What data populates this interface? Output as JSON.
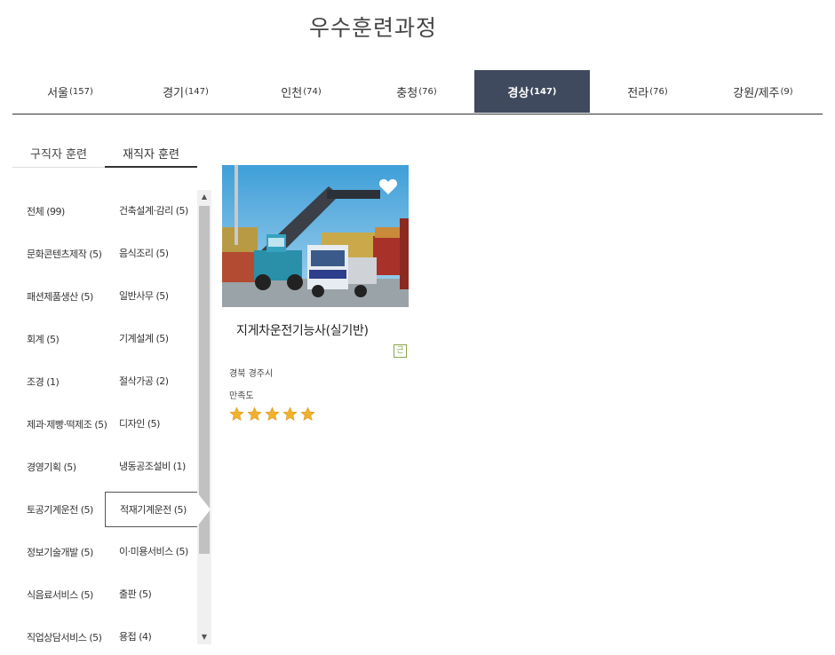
{
  "page": {
    "title": "우수훈련과정"
  },
  "region_tabs": [
    {
      "label": "서울",
      "count": "(157)",
      "active": false
    },
    {
      "label": "경기",
      "count": "(147)",
      "active": false
    },
    {
      "label": "인천",
      "count": "(74)",
      "active": false
    },
    {
      "label": "충청",
      "count": "(76)",
      "active": false
    },
    {
      "label": "경상",
      "count": "(147)",
      "active": true
    },
    {
      "label": "전라",
      "count": "(76)",
      "active": false
    },
    {
      "label": "강원/제주",
      "count": "(9)",
      "active": false
    }
  ],
  "sub_tabs": [
    {
      "label": "구직자 훈련",
      "active": false
    },
    {
      "label": "재직자 훈련",
      "active": true
    }
  ],
  "categories": [
    [
      "전체 (99)",
      "건축설계·감리 (5)"
    ],
    [
      "문화콘텐츠제작 (5)",
      "음식조리 (5)"
    ],
    [
      "패션제품생산 (5)",
      "일반사무 (5)"
    ],
    [
      "회계 (5)",
      "기계설계 (5)"
    ],
    [
      "조경 (1)",
      "절삭가공 (2)"
    ],
    [
      "제과·제빵·떡제조 (5)",
      "디자인 (5)"
    ],
    [
      "경영기획 (5)",
      "냉동공조설비 (1)"
    ],
    [
      "토공기계운전 (5)",
      "적재기계운전 (5)"
    ],
    [
      "정보기술개발 (5)",
      "이·미용서비스 (5)"
    ],
    [
      "식음료서비스 (5)",
      "출판 (5)"
    ],
    [
      "직업상담서비스 (5)",
      "용접 (4)"
    ]
  ],
  "selected_category": "적재기계운전 (5)",
  "course": {
    "title": "지게차운전기능사(실기반)",
    "badge": "근",
    "location": "경북 경주시",
    "satisfaction_label": "만족도",
    "rating": 5,
    "rating_max": 5
  },
  "colors": {
    "active_tab": "#3f4a5e",
    "star": "#f1b12c",
    "badge": "#8aa64b"
  }
}
